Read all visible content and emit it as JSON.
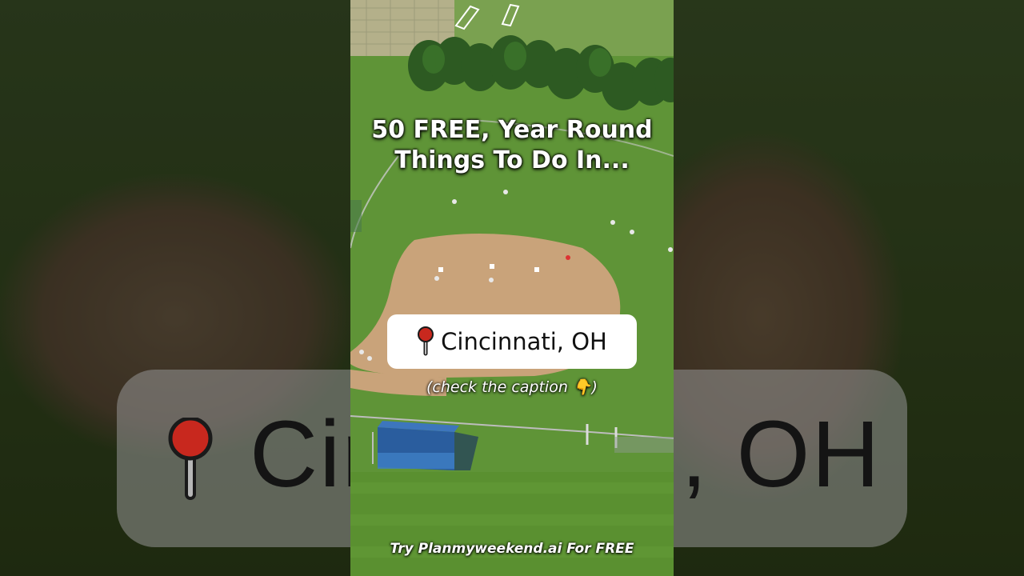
{
  "video": {
    "title": "50 FREE, Year Round\nThings To Do In...",
    "location_label": "Cincinnati, OH",
    "caption_hint": "(check the caption 👇)",
    "footer_cta": "Try Planmyweekend.ai For FREE",
    "location_icon": "round-pushpin-icon",
    "background_sticker_text": "Cincinnati, OH"
  },
  "colors": {
    "grass": "#5f9437",
    "infield_dirt": "#c9a37a",
    "pill_background": "#ffffff",
    "pin_red": "#c8281e",
    "building_blue": "#2a5d9e"
  }
}
